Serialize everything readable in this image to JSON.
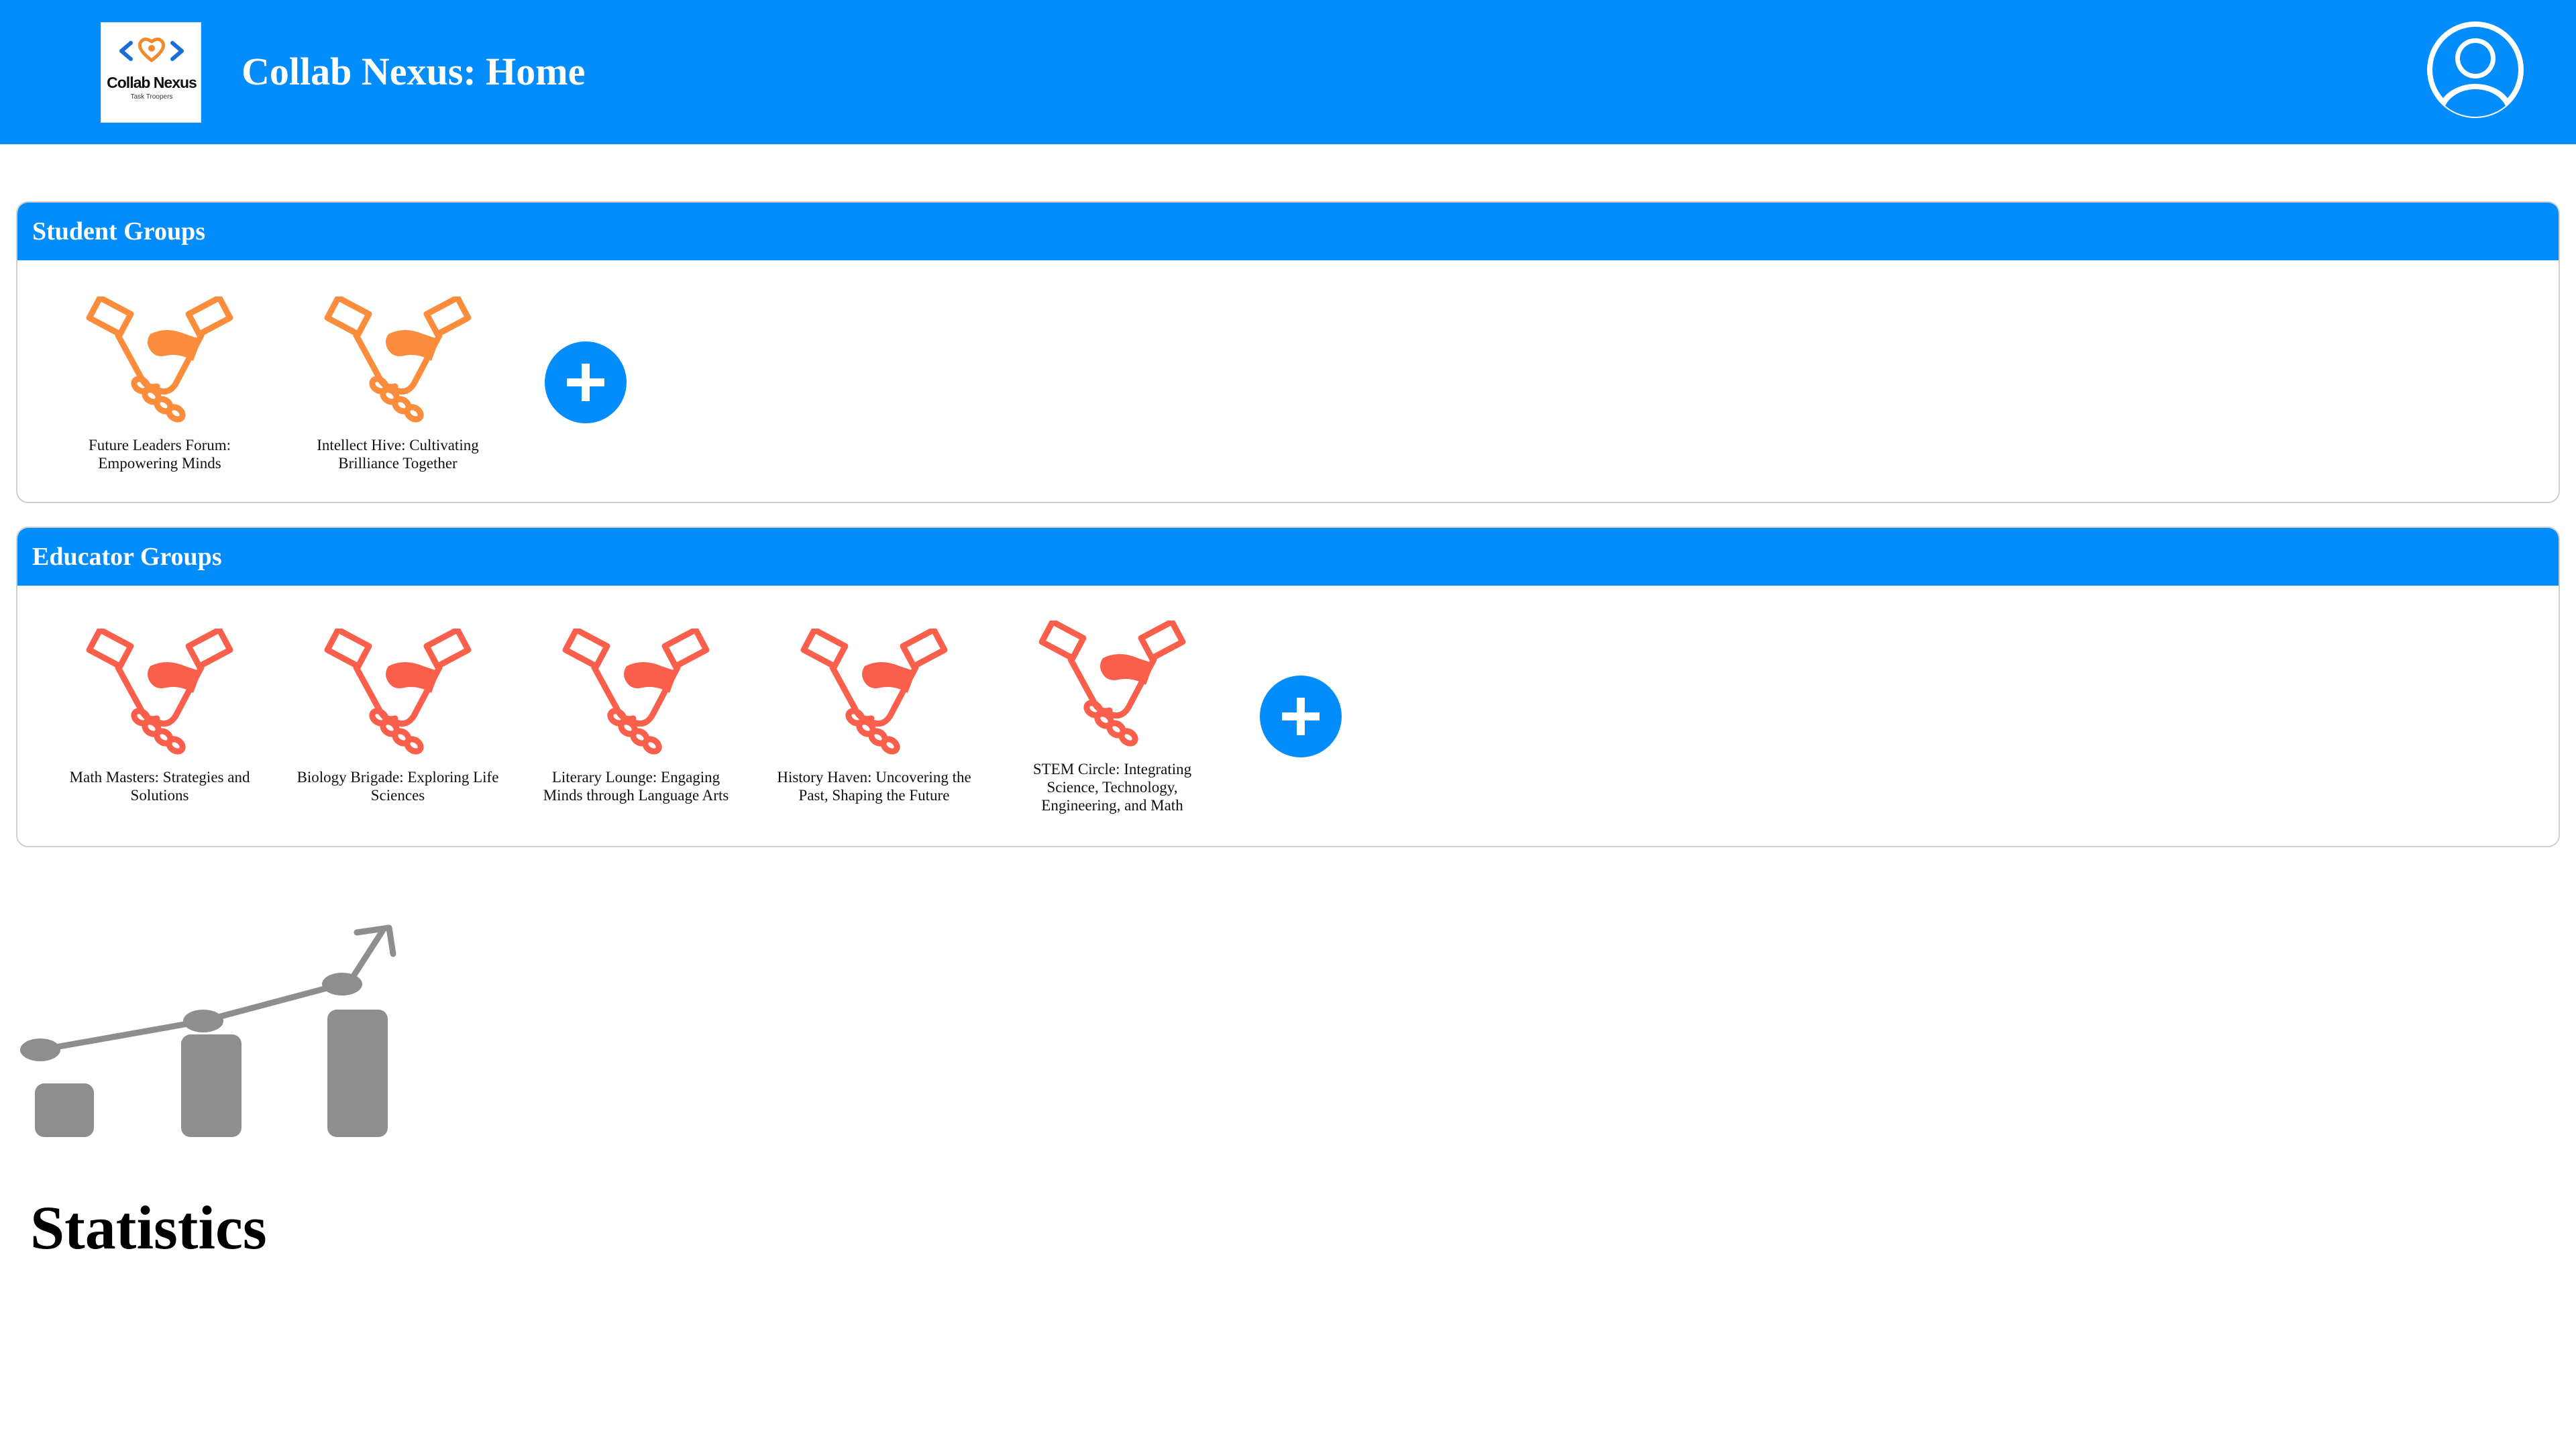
{
  "header": {
    "logo_title": "Collab Nexus",
    "logo_subtitle": "Task Troopers",
    "title": "Collab Nexus: Home",
    "profile_icon": "user-avatar-icon"
  },
  "student_groups": {
    "title": "Student Groups",
    "icon": "handshake-icon",
    "icon_color": "#fa8c3c",
    "items": [
      {
        "label": "Future Leaders Forum: Empowering Minds"
      },
      {
        "label": "Intellect Hive: Cultivating Brilliance Together"
      }
    ],
    "add_icon": "plus-icon"
  },
  "educator_groups": {
    "title": "Educator Groups",
    "icon": "handshake-icon",
    "icon_color": "#fa5f4b",
    "items": [
      {
        "label": "Math Masters: Strategies and Solutions"
      },
      {
        "label": "Biology Brigade: Exploring Life Sciences"
      },
      {
        "label": "Literary Lounge: Engaging Minds through Language Arts"
      },
      {
        "label": "History Haven: Uncovering the Past, Shaping the Future"
      },
      {
        "label": "STEM Circle: Integrating Science, Technology, Engineering, and Math"
      }
    ],
    "add_icon": "plus-icon"
  },
  "statistics": {
    "title": "Statistics",
    "icon": "bar-chart-trend-icon",
    "icon_color": "#8e8e8e"
  },
  "colors": {
    "brand_blue": "#038cfc",
    "panel_border": "#cfcfcf"
  }
}
